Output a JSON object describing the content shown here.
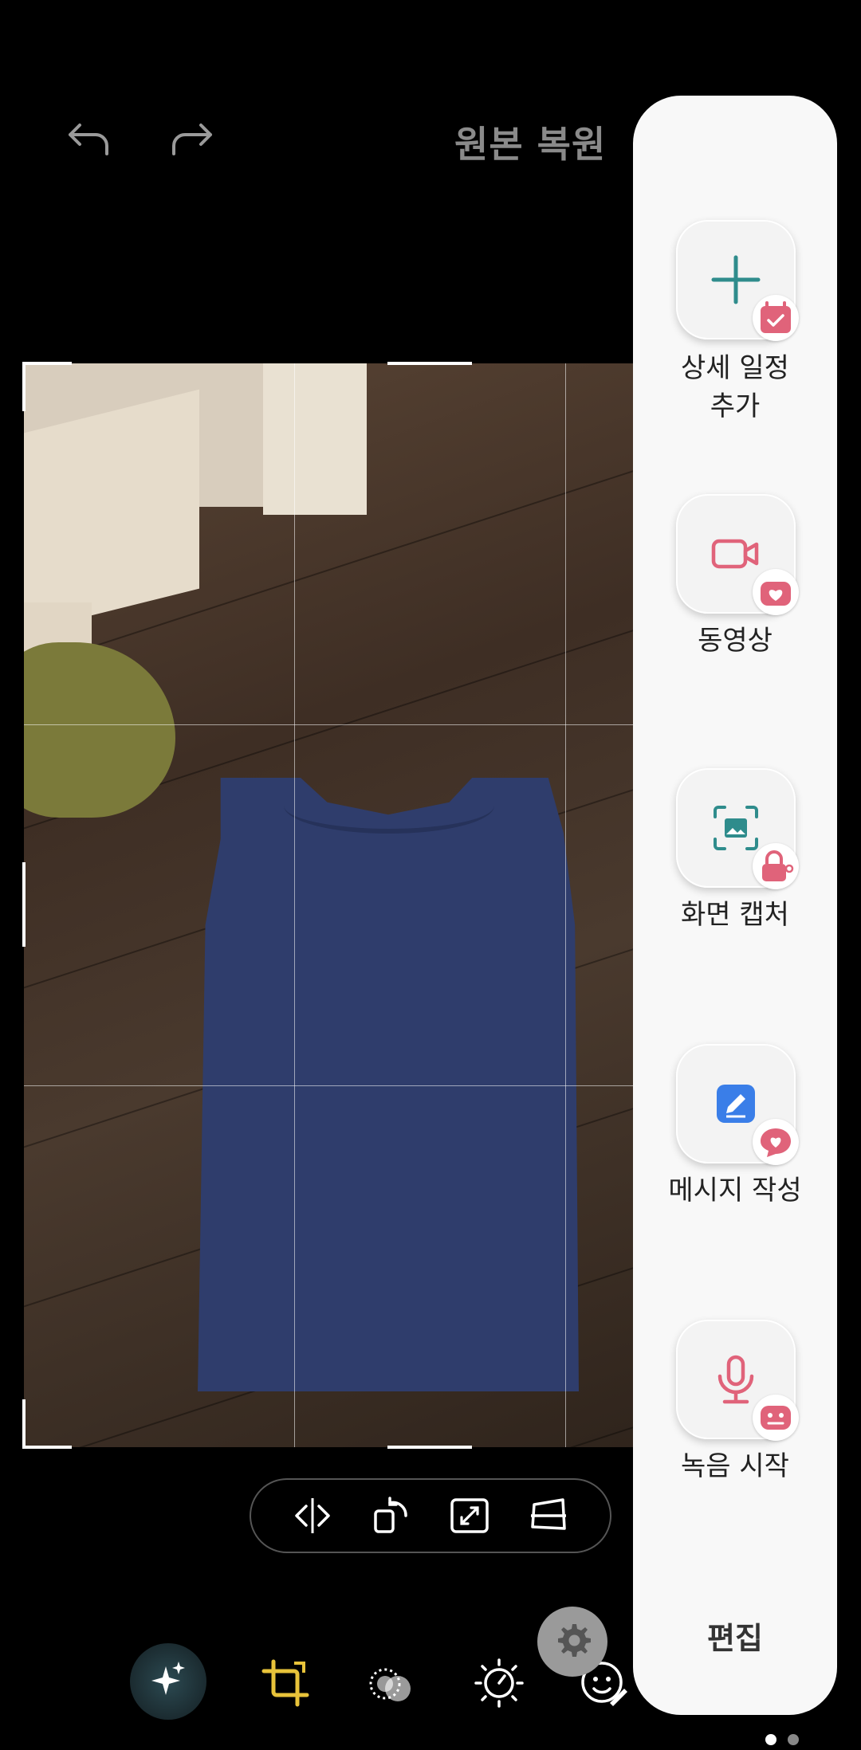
{
  "top_bar": {
    "undo_icon": "undo-icon",
    "redo_icon": "redo-icon",
    "revert_label": "원본 복원"
  },
  "crop_tools": [
    "flip-icon",
    "rotate-icon",
    "aspect-ratio-icon",
    "perspective-icon"
  ],
  "editor_tabs": [
    "auto-enhance-icon",
    "crop-icon",
    "filter-icon",
    "brightness-icon",
    "sticker-icon"
  ],
  "settings_icon": "gear-icon",
  "edge_panel": {
    "shortcuts": [
      {
        "label_line1": "상세 일정",
        "label_line2": "추가",
        "icon": "plus-icon",
        "badge": "calendar-icon"
      },
      {
        "label_line1": "동영상",
        "label_line2": "",
        "icon": "video-camera-icon",
        "badge": "camera-heart-icon"
      },
      {
        "label_line1": "화면 캡처",
        "label_line2": "",
        "icon": "screen-capture-icon",
        "badge": "lock-key-icon"
      },
      {
        "label_line1": "메시지 작성",
        "label_line2": "",
        "icon": "compose-message-icon",
        "badge": "chat-heart-icon"
      },
      {
        "label_line1": "녹음 시작",
        "label_line2": "",
        "icon": "microphone-icon",
        "badge": "recorder-face-icon"
      }
    ],
    "edit_label": "편집"
  },
  "colors": {
    "accent_yellow": "#e8c33a",
    "panel_bg": "#f8f8f8",
    "pink": "#e0637a",
    "teal": "#2f8c8c"
  },
  "pagination": {
    "active_page": 1,
    "total_pages": 2
  }
}
